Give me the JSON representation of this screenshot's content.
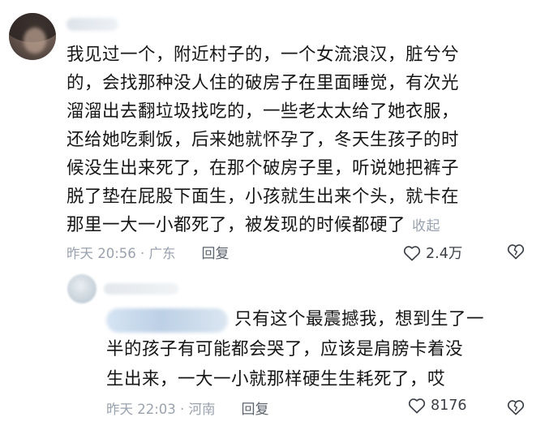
{
  "comment": {
    "lines": [
      "我见过一个，附近村子的，一个女流浪汉，脏兮兮",
      "的，会找那种没人住的破房子在里面睡觉，有次光",
      "溜溜出去翻垃圾找吃的，一些老太太给了她衣服，",
      "还给她吃剩饭，后来她就怀孕了，冬天生孩子的时",
      "候没生出来死了，在那个破房子里，听说她把裤子",
      "脱了垫在屁股下面生，小孩就生出来个头，就卡在",
      "那里一大一小都死了，被发现的时候都硬了"
    ],
    "collapse_label": "收起",
    "meta": "昨天 20:56 · 广东",
    "reply_label": "回复",
    "like_count": "2.4万"
  },
  "reply": {
    "lines": [
      "只有这个最震撼我，想到生了一",
      "半的孩子有可能都会哭了，应该是肩膀卡着没",
      "生出来，一大一小就那样硬生生耗死了，哎"
    ],
    "meta": "昨天 22:03 · 河南",
    "reply_label": "回复",
    "like_count": "8176"
  },
  "colors": {
    "text": "#161616",
    "muted": "#9aa2ad",
    "action": "#5c636d",
    "icon": "#3b3f45"
  },
  "icons": [
    "heart-outline-icon",
    "broken-heart-icon"
  ]
}
